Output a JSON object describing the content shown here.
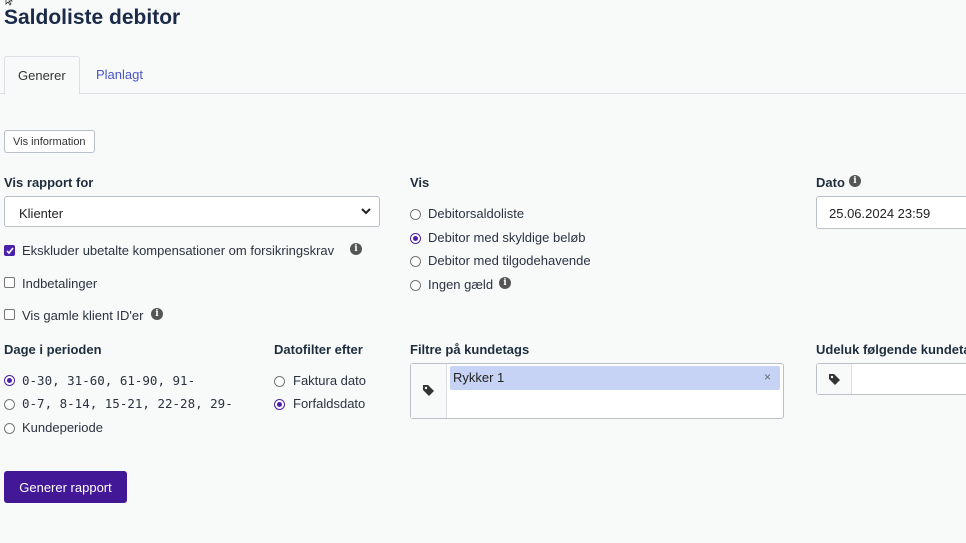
{
  "page": {
    "title": "Saldoliste debitor"
  },
  "tabs": [
    {
      "label": "Generer",
      "active": true
    },
    {
      "label": "Planlagt",
      "active": false
    }
  ],
  "info_button": {
    "label": "Vis information"
  },
  "report_for": {
    "label": "Vis rapport for",
    "selected": "Klienter",
    "checkboxes": [
      {
        "label": "Ekskluder ubetalte kompensationer om forsikringskrav",
        "checked": true,
        "info_icon": "info-icon"
      },
      {
        "label": "Indbetalinger",
        "checked": false
      },
      {
        "label": "Vis gamle klient ID'er",
        "checked": false,
        "info_icon": "info-icon"
      }
    ]
  },
  "vis": {
    "label": "Vis",
    "options": [
      {
        "label": "Debitorsaldoliste",
        "selected": false
      },
      {
        "label": "Debitor med skyldige beløb",
        "selected": true
      },
      {
        "label": "Debitor med tilgodehavende",
        "selected": false
      },
      {
        "label": "Ingen gæld",
        "selected": false,
        "info_icon": "info-icon"
      }
    ]
  },
  "dato": {
    "label": "Dato",
    "value": "25.06.2024 23:59"
  },
  "periods": {
    "label": "Dage i perioden",
    "options": [
      {
        "label": "0-30, 31-60, 61-90, 91-",
        "selected": true
      },
      {
        "label": "0-7, 8-14, 15-21, 22-28, 29-",
        "selected": false
      },
      {
        "label": "Kundeperiode",
        "selected": false
      }
    ]
  },
  "datefilter": {
    "label": "Datofilter efter",
    "options": [
      {
        "label": "Faktura dato",
        "selected": false
      },
      {
        "label": "Forfaldsdato",
        "selected": true
      }
    ]
  },
  "tag_filter": {
    "label": "Filtre på kundetags",
    "tags": [
      {
        "label": "Rykker 1",
        "remove": "×"
      }
    ]
  },
  "exclude_tags": {
    "label": "Udeluk følgende kundetags"
  },
  "generate_button": {
    "label": "Generer rapport"
  },
  "colors": {
    "accent": "#431897",
    "tab_link": "#4a54c9",
    "chip": "#c7d3f5"
  }
}
